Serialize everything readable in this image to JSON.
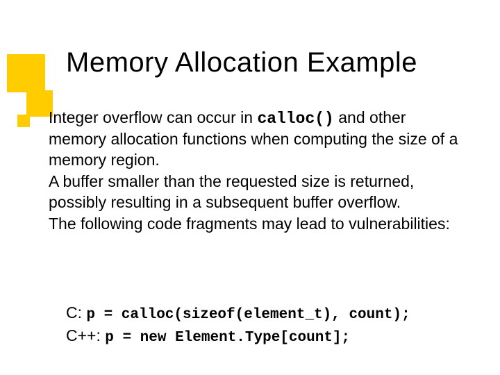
{
  "title": "Memory Allocation Example",
  "body": {
    "p1_a": "Integer overflow can occur in ",
    "p1_code": "calloc()",
    "p1_b": " and other memory allocation functions when computing the size of a memory region.",
    "p2": "A buffer smaller than the requested size is returned, possibly resulting in a subsequent buffer overflow.",
    "p3": "The following code fragments may lead to vulnerabilities:"
  },
  "code": {
    "c_label": "C: ",
    "c_line": "p = calloc(sizeof(element_t), count);",
    "cpp_label": "C++: ",
    "cpp_line": "p = new Element.Type[count];"
  }
}
